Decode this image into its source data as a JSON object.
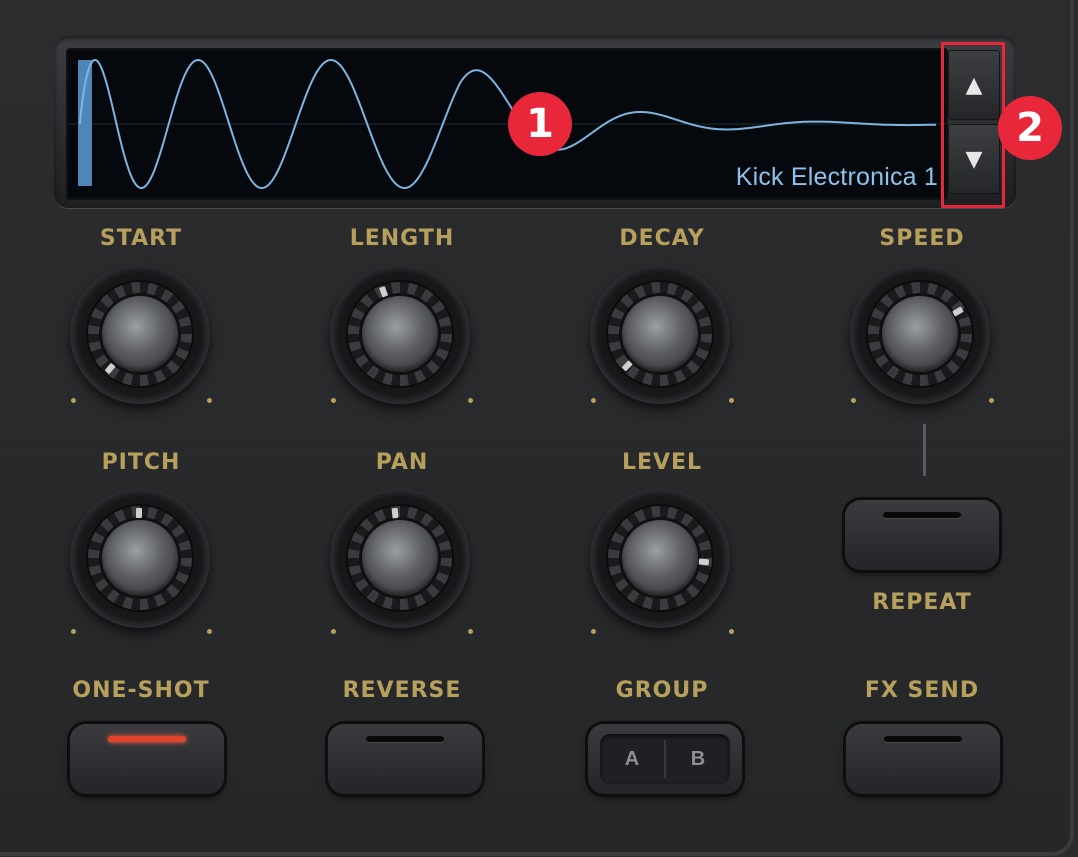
{
  "display": {
    "sample_name": "Kick Electronica 1",
    "up_symbol": "▲",
    "down_symbol": "▼",
    "waveform_color": "#7fb4de",
    "accent_color": "#e8283a"
  },
  "annotations": {
    "badge_1": "1",
    "badge_2": "2"
  },
  "knobs": {
    "start": "START",
    "length": "LENGTH",
    "decay": "DECAY",
    "speed": "SPEED",
    "pitch": "PITCH",
    "pan": "PAN",
    "level": "LEVEL"
  },
  "buttons": {
    "repeat": "REPEAT",
    "one_shot": "ONE-SHOT",
    "reverse": "REVERSE",
    "group": "GROUP",
    "group_a": "A",
    "group_b": "B",
    "fx_send": "FX SEND"
  },
  "colors": {
    "label": "#b7a05c",
    "led_on": "#e0442c"
  }
}
